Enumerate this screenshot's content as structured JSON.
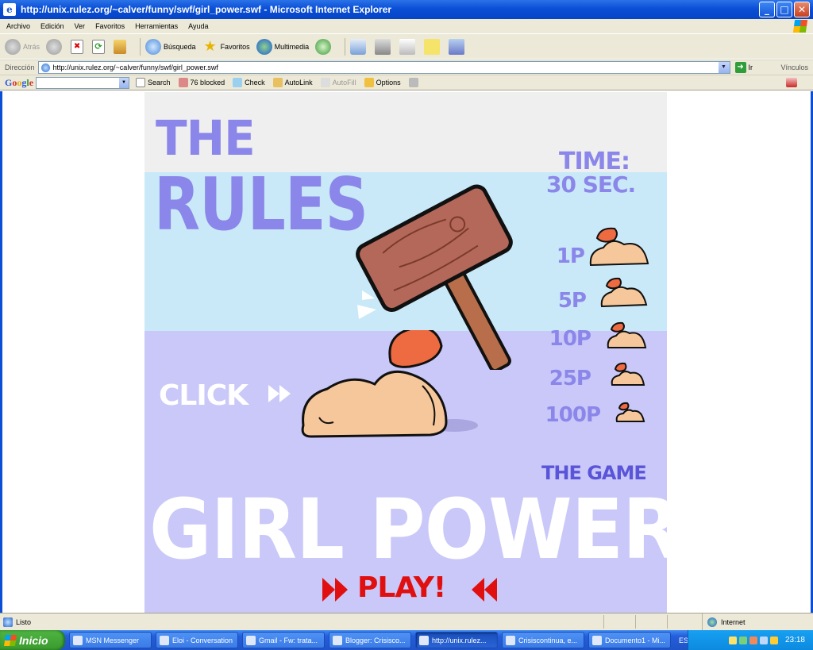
{
  "window": {
    "title": "http://unix.rulez.org/~calver/funny/swf/girl_power.swf - Microsoft Internet Explorer",
    "minimize": "_",
    "maximize": "□",
    "close": "✕"
  },
  "menu": [
    "Archivo",
    "Edición",
    "Ver",
    "Favoritos",
    "Herramientas",
    "Ayuda"
  ],
  "toolbar": {
    "back": "Atrás",
    "search": "Búsqueda",
    "favorites": "Favoritos",
    "media": "Multimedia"
  },
  "address": {
    "label": "Dirección",
    "url": "http://unix.rulez.org/~calver/funny/swf/girl_power.swf",
    "go": "Ir",
    "links": "Vínculos"
  },
  "google_bar": {
    "logo_parts": [
      "G",
      "o",
      "o",
      "g",
      "l",
      "e"
    ],
    "search": "Search",
    "blocked": "76 blocked",
    "check": "Check",
    "autolink": "AutoLink",
    "autofill": "AutoFill",
    "options": "Options"
  },
  "game": {
    "rules_the": "THE",
    "rules_title": "RULES",
    "time_label": "TIME:",
    "time_value": "30 SEC.",
    "points": [
      "1P",
      "5P",
      "10P",
      "25P",
      "100P"
    ],
    "click_label": "CLICK",
    "game_the": "THE GAME",
    "game_title": "GIRL POWER",
    "play": "PLAY!"
  },
  "status": {
    "text": "Listo",
    "zone": "Internet"
  },
  "taskbar": {
    "start": "Inicio",
    "tasks": [
      "MSN Messenger",
      "Eloi - Conversation",
      "Gmail - Fw: trata...",
      "Blogger: Crisisco...",
      "http://unix.rulez...",
      "Crisiscontinua, e...",
      "Documento1 - Mi..."
    ],
    "language": "ES",
    "clock": "23:18"
  },
  "colors": {
    "title_purple": "#8b86ea",
    "band_gray": "#efefef",
    "band_blue": "#c9e9f8",
    "band_lavender": "#cac8f8",
    "play_red": "#e01010"
  }
}
